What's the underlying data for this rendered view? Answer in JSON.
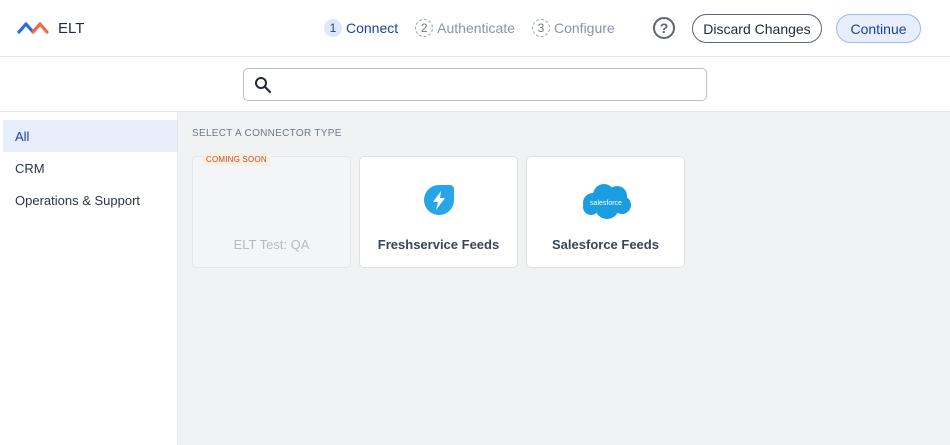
{
  "app": {
    "title": "ELT",
    "brand_color": "#2b6bdf",
    "accent_color": "#f26a3d"
  },
  "steps": [
    {
      "num": "1",
      "label": "Connect",
      "state": "active"
    },
    {
      "num": "2",
      "label": "Authenticate",
      "state": "pending"
    },
    {
      "num": "3",
      "label": "Configure",
      "state": "pending"
    }
  ],
  "header": {
    "help_icon": "question-circle-icon",
    "help_label": "?",
    "discard_label": "Discard Changes",
    "continue_label": "Continue"
  },
  "search": {
    "icon": "search-icon",
    "value": "",
    "placeholder": ""
  },
  "sidebar": {
    "items": [
      {
        "label": "All",
        "active": true
      },
      {
        "label": "CRM",
        "active": false
      },
      {
        "label": "Operations & Support",
        "active": false
      }
    ]
  },
  "main": {
    "section_label": "SELECT A CONNECTOR TYPE",
    "connectors": [
      {
        "name": "ELT Test: QA",
        "badge": "COMING SOON",
        "disabled": true,
        "icon": "none"
      },
      {
        "name": "Freshservice Feeds",
        "disabled": false,
        "icon": "freshservice-icon"
      },
      {
        "name": "Salesforce Feeds",
        "disabled": false,
        "icon": "salesforce-icon",
        "icon_text": "salesforce"
      }
    ]
  }
}
